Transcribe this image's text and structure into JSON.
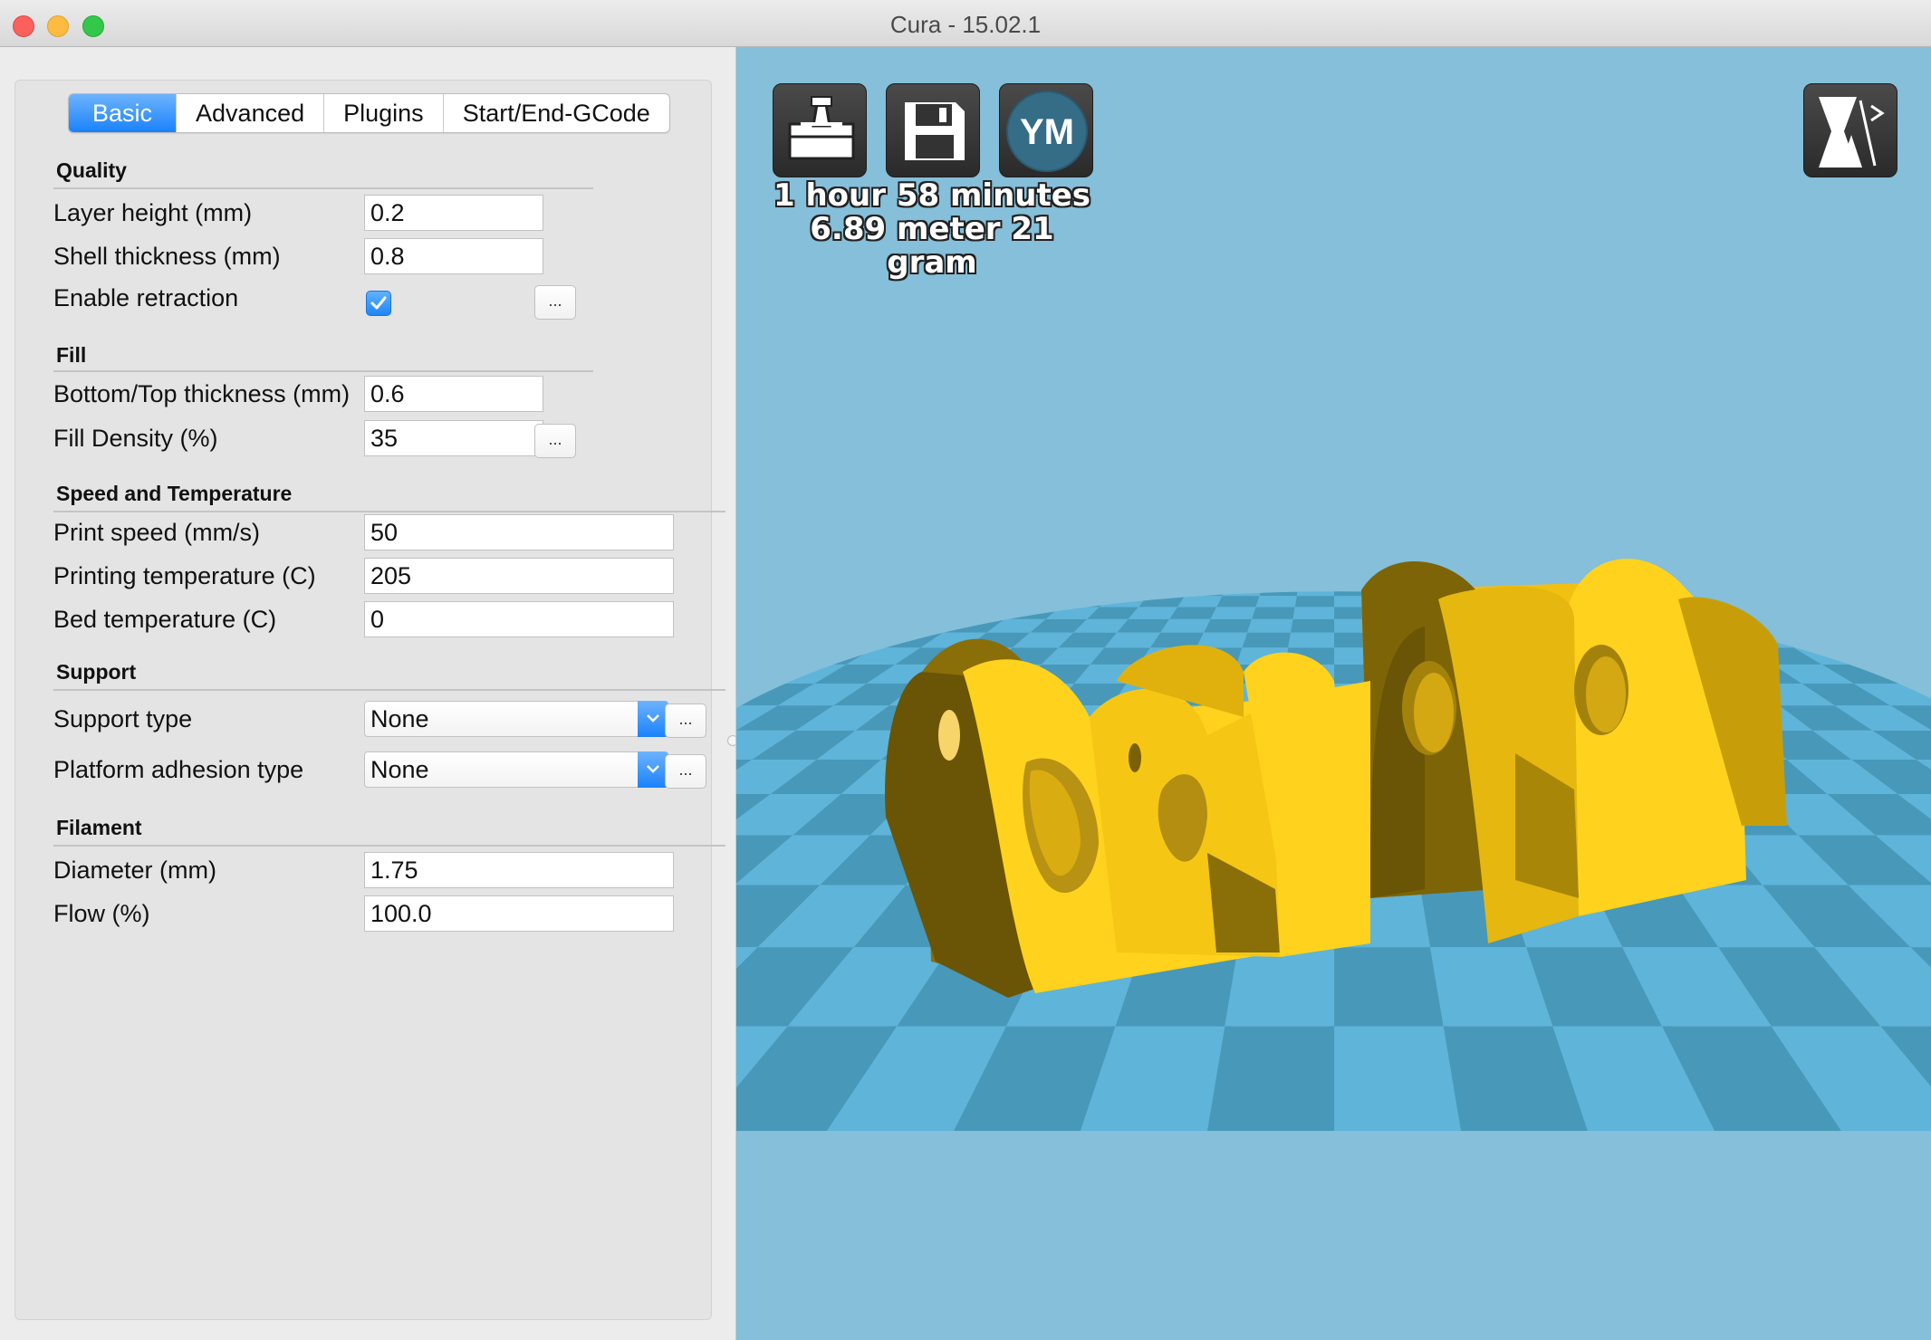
{
  "window": {
    "title": "Cura - 15.02.1"
  },
  "tabs": [
    {
      "label": "Basic",
      "active": true
    },
    {
      "label": "Advanced",
      "active": false
    },
    {
      "label": "Plugins",
      "active": false
    },
    {
      "label": "Start/End-GCode",
      "active": false
    }
  ],
  "quality": {
    "title": "Quality",
    "layer_height": {
      "label": "Layer height (mm)",
      "value": "0.2"
    },
    "shell_thickness": {
      "label": "Shell thickness (mm)",
      "value": "0.8"
    },
    "enable_retraction": {
      "label": "Enable retraction",
      "checked": true
    }
  },
  "fill": {
    "title": "Fill",
    "bottom_top": {
      "label": "Bottom/Top thickness (mm)",
      "value": "0.6"
    },
    "density": {
      "label": "Fill Density (%)",
      "value": "35"
    }
  },
  "speed": {
    "title": "Speed and Temperature",
    "print_speed": {
      "label": "Print speed (mm/s)",
      "value": "50"
    },
    "print_temp": {
      "label": "Printing temperature (C)",
      "value": "205"
    },
    "bed_temp": {
      "label": "Bed temperature (C)",
      "value": "0"
    }
  },
  "support": {
    "title": "Support",
    "support_type": {
      "label": "Support type",
      "value": "None"
    },
    "adhesion_type": {
      "label": "Platform adhesion type",
      "value": "None"
    }
  },
  "filament": {
    "title": "Filament",
    "diameter": {
      "label": "Diameter (mm)",
      "value": "1.75"
    },
    "flow": {
      "label": "Flow (%)",
      "value": "100.0"
    }
  },
  "more_button_label": "...",
  "viewport": {
    "youmagine_label": "YM",
    "print_time": "1 hour 58 minutes",
    "print_material": "6.89 meter 21 gram",
    "icons": [
      "print-to-sd-icon",
      "save-gcode-icon",
      "youmagine-icon",
      "view-mode-icon"
    ],
    "colors": {
      "background": "#85bfd9",
      "bed_light": "#5fb4da",
      "bed_dark": "#4898b9",
      "model": "#ffd21e"
    }
  }
}
